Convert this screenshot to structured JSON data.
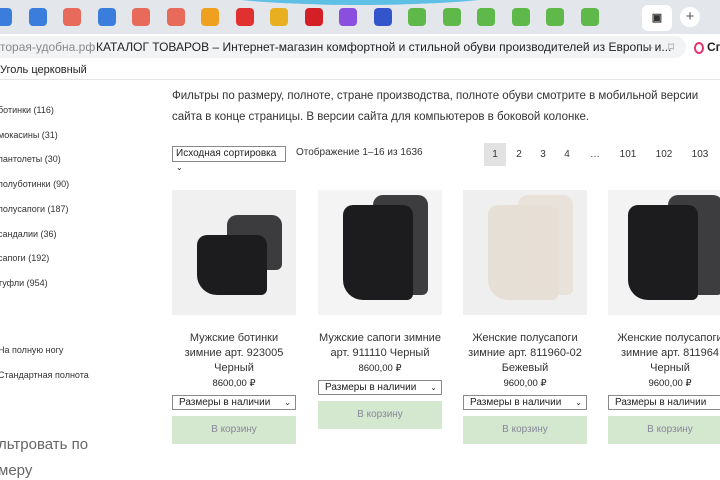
{
  "browser": {
    "tabs": [
      {
        "icon": "mail-icon",
        "color": "#3b7ddd"
      },
      {
        "icon": "bolt-icon",
        "color": "#3b7ddd"
      },
      {
        "icon": "yandex-icon",
        "color": "#e86a5a"
      },
      {
        "icon": "cloud-icon",
        "color": "#3b7ddd"
      },
      {
        "icon": "yandex-icon",
        "color": "#e86a5a"
      },
      {
        "icon": "yandex-icon",
        "color": "#e86a5a"
      },
      {
        "icon": "arrow-icon",
        "color": "#f0a020"
      },
      {
        "icon": "five-icon",
        "color": "#e03030"
      },
      {
        "icon": "image-icon",
        "color": "#e8b020"
      },
      {
        "icon": "hh-icon",
        "color": "#d51f27"
      },
      {
        "icon": "yu-icon",
        "color": "#8a4fdf"
      },
      {
        "icon": "site-icon",
        "color": "#3355cc"
      },
      {
        "icon": "leaf-icon",
        "color": "#5fb84a"
      },
      {
        "icon": "leaf-icon",
        "color": "#5fb84a"
      },
      {
        "icon": "leaf-icon",
        "color": "#5fb84a"
      },
      {
        "icon": "leaf-icon",
        "color": "#5fb84a"
      },
      {
        "icon": "leaf-icon",
        "color": "#5fb84a"
      },
      {
        "icon": "leaf-icon",
        "color": "#5fb84a"
      }
    ],
    "domain": "торая-удобна.рф",
    "page_title": "КАТАЛОГ ТОВАРОВ – Интернет-магазин комфортной и стильной обуви производителей из Европы и...",
    "more": "···",
    "alice": "Сп",
    "bookmark": "Уголь церковный"
  },
  "sidebar": {
    "categories": [
      "ботинки (116)",
      "мокасины (31)",
      "пантолеты (30)",
      "полуботинки (90)",
      "полусапоги (187)",
      "сандалии (36)",
      "сапоги (192)",
      "туфли (954)"
    ],
    "fullness": [
      "На полную ногу",
      "Стандартная полнота"
    ],
    "filter_heading_1": "льтровать по",
    "filter_heading_2": "меру"
  },
  "main": {
    "intro": "Фильтры по размеру, полноте, стране производства, полноте обуви смотрите в мобильной версии сайта в конце страницы. В версии сайта для компьютеров в боковой колонке.",
    "sort": "Исходная сортировка",
    "count": "Отображение 1–16 из 1636",
    "pages": [
      "1",
      "2",
      "3",
      "4",
      "…",
      "101",
      "102",
      "103"
    ],
    "products": [
      {
        "name": "Мужские ботинки зимние арт. 923005 Черный",
        "price": "8600,00 ₽",
        "sizes": "Размеры в наличии",
        "cart": "В корзину"
      },
      {
        "name": "Мужские сапоги зимние арт. 911110 Черный",
        "price": "8600,00 ₽",
        "sizes": "Размеры в наличии",
        "cart": "В корзину"
      },
      {
        "name": "Женские полусапоги зимние арт. 811960-02 Бежевый",
        "price": "9600,00 ₽",
        "sizes": "Размеры в наличии",
        "cart": "В корзину"
      },
      {
        "name": "Женские полусапоги зимние арт. 811964 Черный",
        "price": "9600,00 ₽",
        "sizes": "Размеры в наличии",
        "cart": "В корзину"
      }
    ]
  }
}
